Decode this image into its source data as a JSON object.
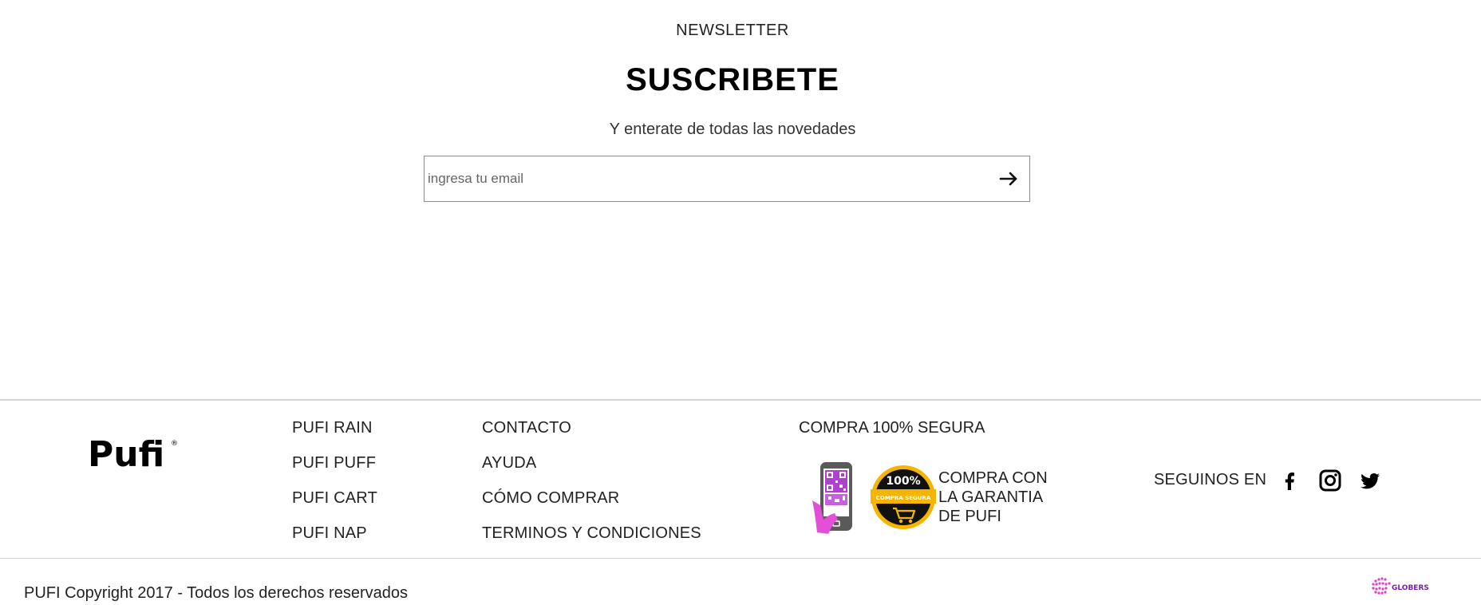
{
  "newsletter": {
    "kicker": "NEWSLETTER",
    "title": "SUSCRIBETE",
    "subtitle": "Y enterate de todas las novedades",
    "email_placeholder": "ingresa tu email",
    "submit_icon": "arrow-right-icon"
  },
  "footer": {
    "logo_text": "Pufi",
    "logo_mark": "®",
    "products": [
      {
        "label": "PUFI RAIN"
      },
      {
        "label": "PUFI PUFF"
      },
      {
        "label": "PUFI CART"
      },
      {
        "label": "PUFI NAP"
      }
    ],
    "info": [
      {
        "label": "CONTACTO"
      },
      {
        "label": "AYUDA"
      },
      {
        "label": "CÓMO COMPRAR"
      },
      {
        "label": "TERMINOS Y CONDICIONES"
      }
    ],
    "secure": {
      "title": "COMPRA 100% SEGURA",
      "badge_percent": "100%",
      "badge_label": "COMPRA SEGURA",
      "lines": [
        "COMPRA CON",
        "LA GARANTIA",
        "DE PUFI"
      ]
    },
    "social": {
      "label": "SEGUINOS EN",
      "icons": [
        "facebook-icon",
        "instagram-icon",
        "twitter-icon"
      ]
    },
    "copyright": "PUFI Copyright 2017 - Todos los derechos reservados",
    "credit_logo_text": "GLOBERS"
  },
  "colors": {
    "text": "#222222",
    "border": "#d4d4d4",
    "badge_gold": "#f5b400",
    "phone_gray": "#5a5a5a",
    "qr_purple": "#b040d0",
    "hand_pink": "#e34fd6"
  }
}
